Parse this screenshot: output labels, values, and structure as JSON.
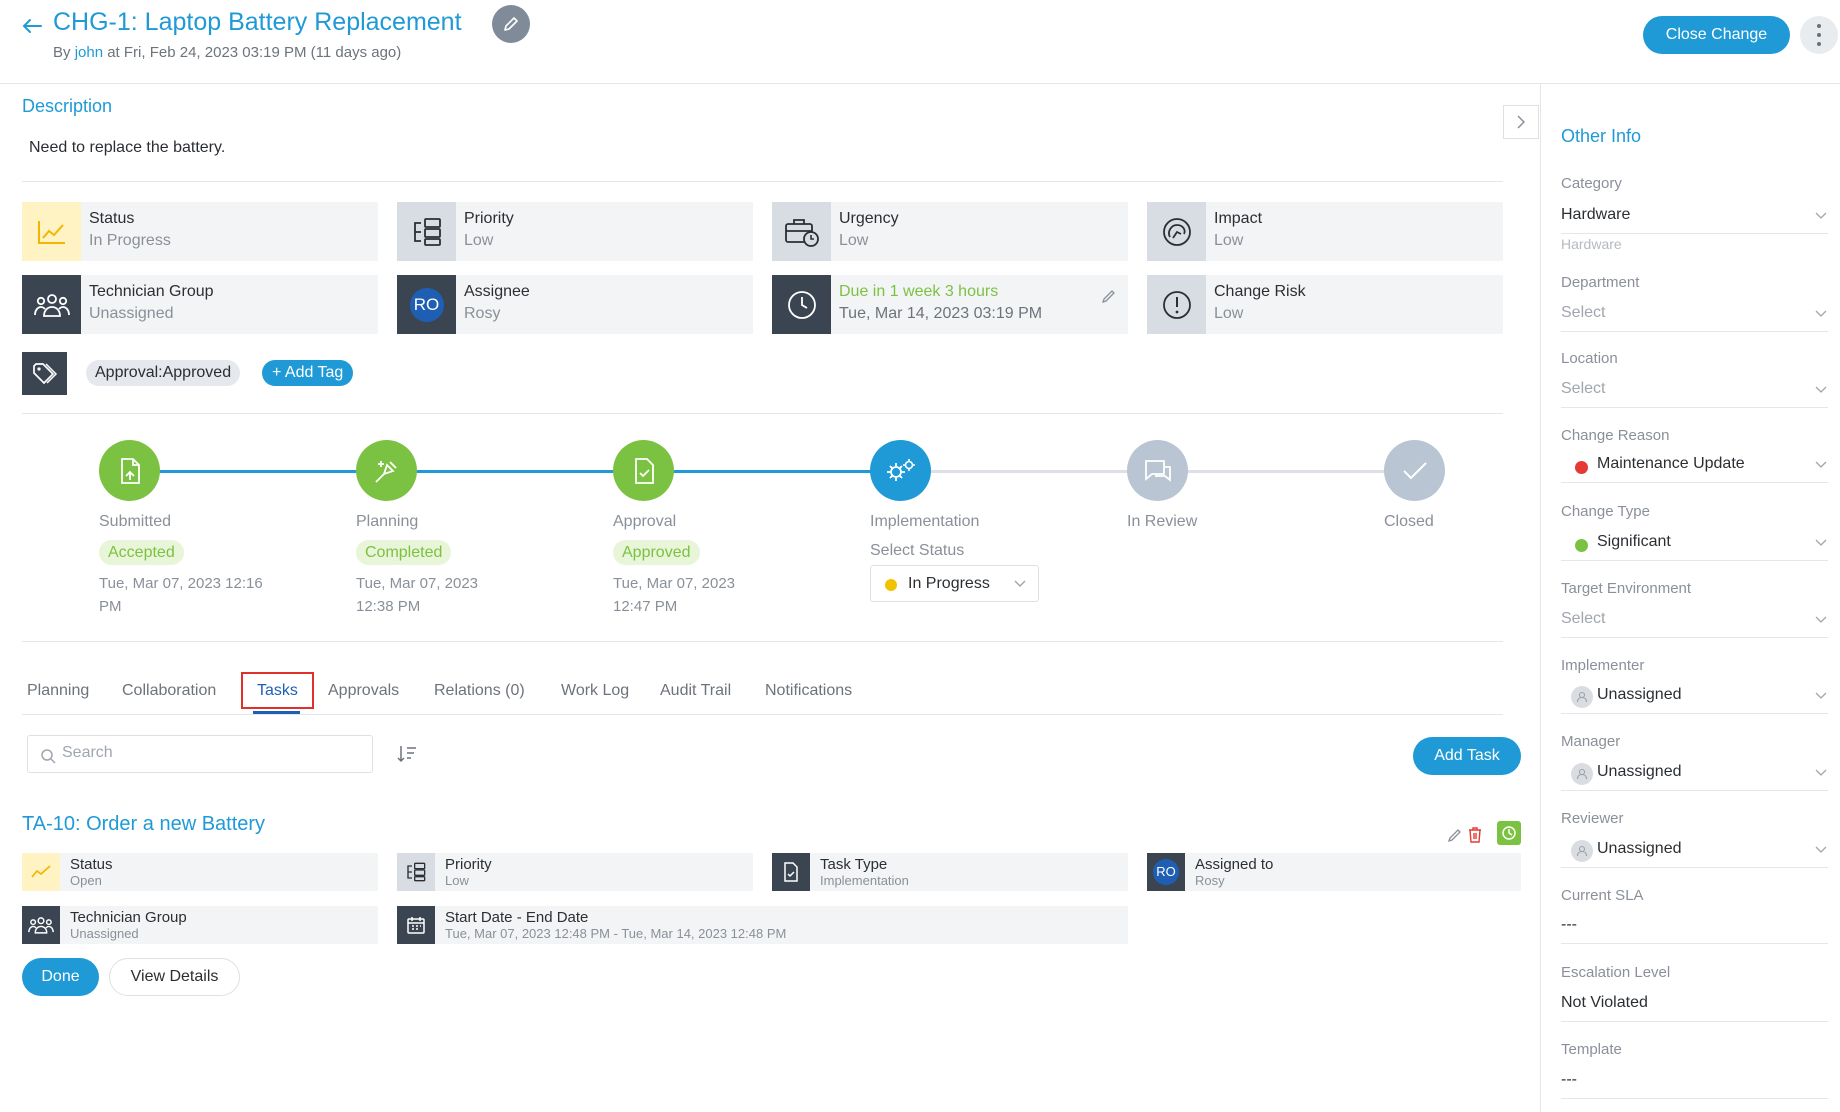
{
  "header": {
    "title": "CHG-1: Laptop Battery Replacement",
    "byline_prefix": "By",
    "byline_user": "john",
    "byline_rest": "at Fri, Feb 24, 2023 03:19 PM (11 days ago)",
    "close_change_label": "Close Change"
  },
  "description": {
    "heading": "Description",
    "text": "Need to replace the battery."
  },
  "info_cards": {
    "status": {
      "label": "Status",
      "value": "In Progress"
    },
    "priority": {
      "label": "Priority",
      "value": "Low"
    },
    "urgency": {
      "label": "Urgency",
      "value": "Low"
    },
    "impact": {
      "label": "Impact",
      "value": "Low"
    },
    "technician_group": {
      "label": "Technician Group",
      "value": "Unassigned"
    },
    "assignee": {
      "label": "Assignee",
      "value": "Rosy",
      "initials": "RO"
    },
    "due": {
      "label": "Due in 1 week 3 hours",
      "value": "Tue, Mar 14, 2023 03:19 PM",
      "color": "#7cc242"
    },
    "change_risk": {
      "label": "Change Risk",
      "value": "Low"
    }
  },
  "tags": {
    "items": [
      "Approval:Approved"
    ],
    "add_label": "+ Add Tag"
  },
  "stepper": {
    "steps": [
      {
        "name": "Submitted",
        "status": "Accepted",
        "date": "Tue, Mar 07, 2023 12:16 PM"
      },
      {
        "name": "Planning",
        "status": "Completed",
        "date": "Tue, Mar 07, 2023 12:38 PM"
      },
      {
        "name": "Approval",
        "status": "Approved",
        "date": "Tue, Mar 07, 2023 12:47 PM"
      },
      {
        "name": "Implementation",
        "select_label": "Select Status",
        "select_value": "In Progress"
      },
      {
        "name": "In Review"
      },
      {
        "name": "Closed"
      }
    ],
    "colors": {
      "done": "#7cc242",
      "active": "#1f9ad6",
      "pending": "#b9c5d2"
    }
  },
  "tabs": [
    {
      "label": "Planning"
    },
    {
      "label": "Collaboration"
    },
    {
      "label": "Tasks"
    },
    {
      "label": "Approvals"
    },
    {
      "label": "Relations (0)"
    },
    {
      "label": "Work Log"
    },
    {
      "label": "Audit Trail"
    },
    {
      "label": "Notifications"
    }
  ],
  "tasks_toolbar": {
    "search_placeholder": "Search",
    "add_task_label": "Add Task"
  },
  "task": {
    "title": "TA-10: Order a new Battery",
    "status": {
      "label": "Status",
      "value": "Open"
    },
    "priority": {
      "label": "Priority",
      "value": "Low"
    },
    "task_type": {
      "label": "Task Type",
      "value": "Implementation"
    },
    "assigned_to": {
      "label": "Assigned to",
      "value": "Rosy",
      "initials": "RO"
    },
    "technician_group": {
      "label": "Technician Group",
      "value": "Unassigned"
    },
    "dates": {
      "label": "Start Date - End Date",
      "value": "Tue, Mar 07, 2023 12:48 PM - Tue, Mar 14, 2023 12:48 PM"
    },
    "done_label": "Done",
    "view_details_label": "View Details"
  },
  "other_info": {
    "heading": "Other Info",
    "category": {
      "label": "Category",
      "value": "Hardware",
      "hint": "Hardware"
    },
    "department": {
      "label": "Department",
      "placeholder": "Select"
    },
    "location": {
      "label": "Location",
      "placeholder": "Select"
    },
    "change_reason": {
      "label": "Change Reason",
      "value": "Maintenance Update",
      "color": "#e53935"
    },
    "change_type": {
      "label": "Change Type",
      "value": "Significant",
      "color": "#7cc242"
    },
    "target_environment": {
      "label": "Target Environment",
      "placeholder": "Select"
    },
    "implementer": {
      "label": "Implementer",
      "value": "Unassigned"
    },
    "manager": {
      "label": "Manager",
      "value": "Unassigned"
    },
    "reviewer": {
      "label": "Reviewer",
      "value": "Unassigned"
    },
    "current_sla": {
      "label": "Current SLA",
      "value": "---"
    },
    "escalation_level": {
      "label": "Escalation Level",
      "value": "Not Violated"
    },
    "template": {
      "label": "Template",
      "value": "---"
    }
  }
}
